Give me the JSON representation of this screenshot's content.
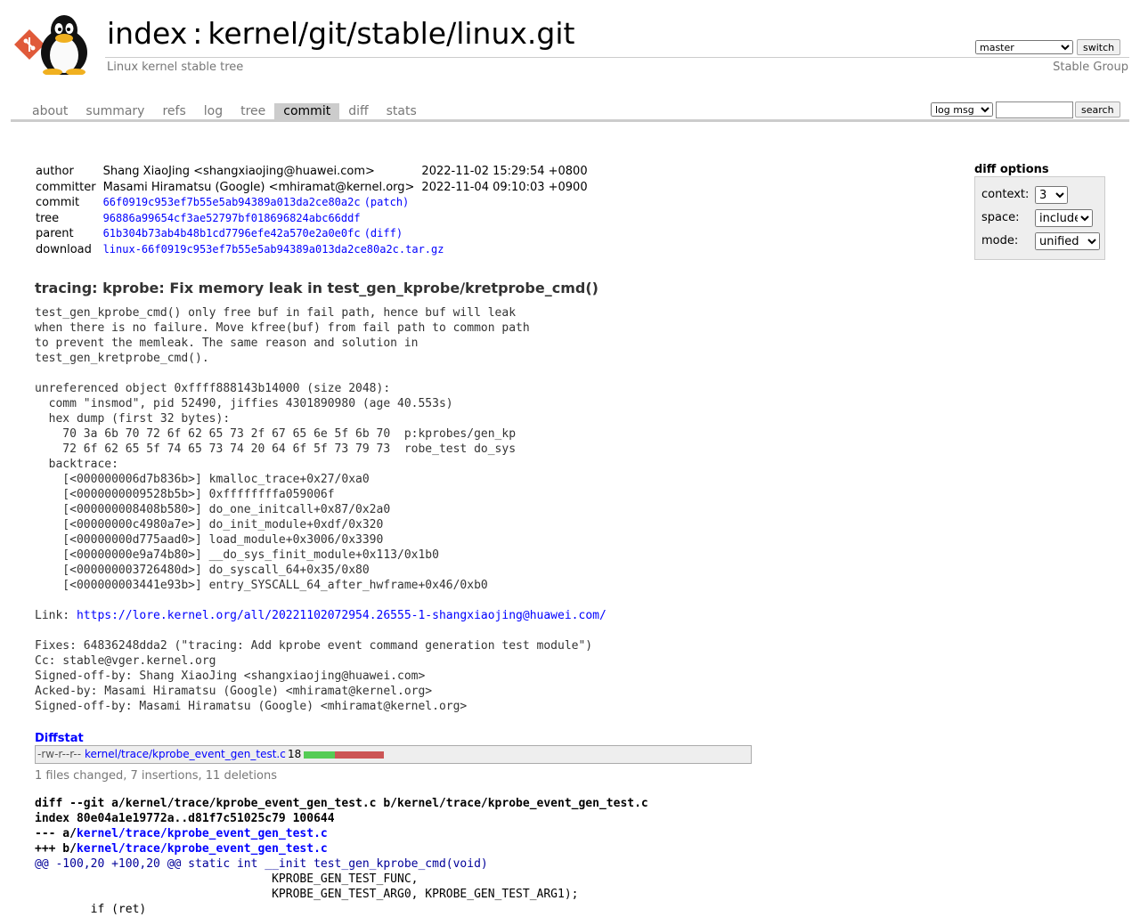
{
  "header": {
    "index_link": "index",
    "separator": ":",
    "repo_name": "kernel/git/stable/linux.git",
    "description": "Linux kernel stable tree",
    "owner": "Stable Group",
    "branch_selected": "master",
    "switch_label": "switch"
  },
  "tabs": [
    {
      "label": "about"
    },
    {
      "label": "summary"
    },
    {
      "label": "refs"
    },
    {
      "label": "log"
    },
    {
      "label": "tree"
    },
    {
      "label": "commit",
      "active": true
    },
    {
      "label": "diff"
    },
    {
      "label": "stats"
    }
  ],
  "search": {
    "scope_selected": "log msg",
    "query": "",
    "button_label": "search"
  },
  "commit_info": {
    "author_label": "author",
    "author": "Shang XiaoJing <shangxiaojing@huawei.com>",
    "author_date": "2022-11-02 15:29:54 +0800",
    "committer_label": "committer",
    "committer": "Masami Hiramatsu (Google) <mhiramat@kernel.org>",
    "committer_date": "2022-11-04 09:10:03 +0900",
    "commit_label": "commit",
    "commit_hash": "66f0919c953ef7b55e5ab94389a013da2ce80a2c",
    "patch_link": "(patch)",
    "tree_label": "tree",
    "tree_hash": "96886a99654cf3ae52797bf018696824abc66ddf",
    "parent_label": "parent",
    "parent_hash": "61b304b73ab4b48b1cd7796efe42a570e2a0e0fc",
    "diff_link": "(diff)",
    "download_label": "download",
    "download_file": "linux-66f0919c953ef7b55e5ab94389a013da2ce80a2c.tar.gz"
  },
  "diff_options": {
    "title": "diff options",
    "context_label": "context:",
    "context_value": "3",
    "space_label": "space:",
    "space_value": "include",
    "mode_label": "mode:",
    "mode_value": "unified"
  },
  "commit_subject": "tracing: kprobe: Fix memory leak in test_gen_kprobe/kretprobe_cmd()",
  "commit_message_before_link": "test_gen_kprobe_cmd() only free buf in fail path, hence buf will leak\nwhen there is no failure. Move kfree(buf) from fail path to common path\nto prevent the memleak. The same reason and solution in\ntest_gen_kretprobe_cmd().\n\nunreferenced object 0xffff888143b14000 (size 2048):\n  comm \"insmod\", pid 52490, jiffies 4301890980 (age 40.553s)\n  hex dump (first 32 bytes):\n    70 3a 6b 70 72 6f 62 65 73 2f 67 65 6e 5f 6b 70  p:kprobes/gen_kp\n    72 6f 62 65 5f 74 65 73 74 20 64 6f 5f 73 79 73  robe_test do_sys\n  backtrace:\n    [<000000006d7b836b>] kmalloc_trace+0x27/0xa0\n    [<0000000009528b5b>] 0xffffffffa059006f\n    [<000000008408b580>] do_one_initcall+0x87/0x2a0\n    [<00000000c4980a7e>] do_init_module+0xdf/0x320\n    [<00000000d775aad0>] load_module+0x3006/0x3390\n    [<00000000e9a74b80>] __do_sys_finit_module+0x113/0x1b0\n    [<000000003726480d>] do_syscall_64+0x35/0x80\n    [<000000003441e93b>] entry_SYSCALL_64_after_hwframe+0x46/0xb0\n\nLink: ",
  "commit_link": "https://lore.kernel.org/all/20221102072954.26555-1-shangxiaojing@huawei.com/",
  "commit_message_after_link": "\n\nFixes: 64836248dda2 (\"tracing: Add kprobe event command generation test module\")\nCc: stable@vger.kernel.org\nSigned-off-by: Shang XiaoJing <shangxiaojing@huawei.com>\nAcked-by: Masami Hiramatsu (Google) <mhiramat@kernel.org>\nSigned-off-by: Masami Hiramatsu (Google) <mhiramat@kernel.org>",
  "diffstat": {
    "title": "Diffstat",
    "mode": "-rw-r--r--",
    "file": "kernel/trace/kprobe_event_gen_test.c",
    "count": "18",
    "insertions": 7,
    "deletions": 11,
    "summary": "1 files changed, 7 insertions, 11 deletions",
    "colors": {
      "insert": "#5c5",
      "delete": "#c55"
    }
  },
  "diff": {
    "git_line": "diff --git a/kernel/trace/kprobe_event_gen_test.c b/kernel/trace/kprobe_event_gen_test.c",
    "index_line": "index 80e04a1e19772a..d81f7c51025c79 100644",
    "minus_prefix": "--- a/",
    "plus_prefix": "+++ b/",
    "file": "kernel/trace/kprobe_event_gen_test.c",
    "hunk_header": "@@ -100,20 +100,20 @@ static int __init test_gen_kprobe_cmd(void)",
    "context_lines": "                                  KPROBE_GEN_TEST_FUNC,\n                                  KPROBE_GEN_TEST_ARG0, KPROBE_GEN_TEST_ARG1);\n        if (ret)"
  }
}
